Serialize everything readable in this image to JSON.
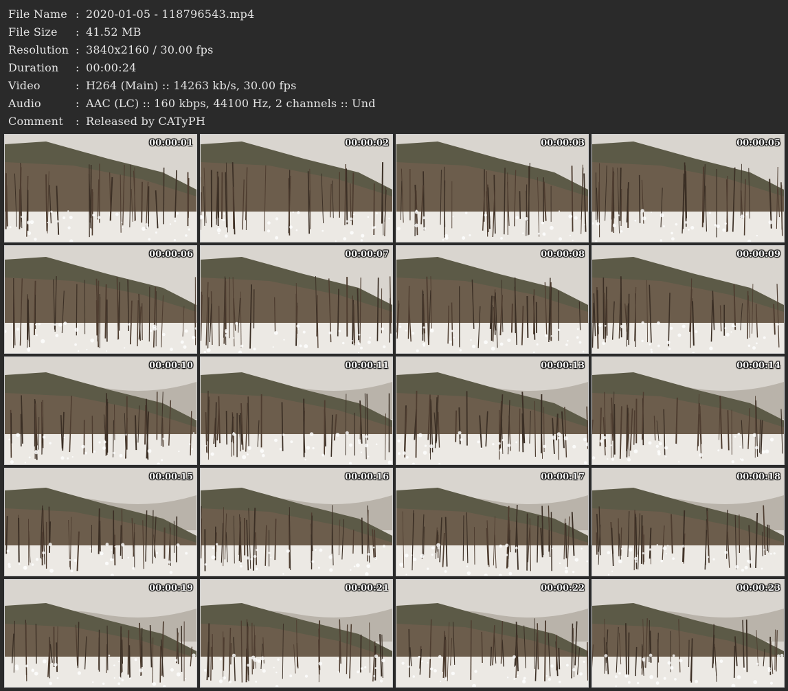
{
  "info": [
    {
      "label": "File Name",
      "value": "2020-01-05 - 118796543.mp4"
    },
    {
      "label": "File Size",
      "value": "41.52 MB"
    },
    {
      "label": "Resolution",
      "value": "3840x2160 / 30.00 fps"
    },
    {
      "label": "Duration",
      "value": "00:00:24"
    },
    {
      "label": "Video",
      "value": "H264 (Main) :: 14263 kb/s, 30.00 fps"
    },
    {
      "label": "Audio",
      "value": "AAC (LC) :: 160 kbps, 44100 Hz, 2 channels :: Und"
    },
    {
      "label": "Comment",
      "value": "Released by CATyPH"
    }
  ],
  "separator": ":",
  "thumbnails": [
    "00:00:01",
    "00:00:02",
    "00:00:03",
    "00:00:05",
    "00:00:06",
    "00:00:07",
    "00:00:08",
    "00:00:09",
    "00:00:10",
    "00:00:11",
    "00:00:13",
    "00:00:14",
    "00:00:15",
    "00:00:16",
    "00:00:17",
    "00:00:18",
    "00:00:19",
    "00:00:21",
    "00:00:22",
    "00:00:23"
  ]
}
